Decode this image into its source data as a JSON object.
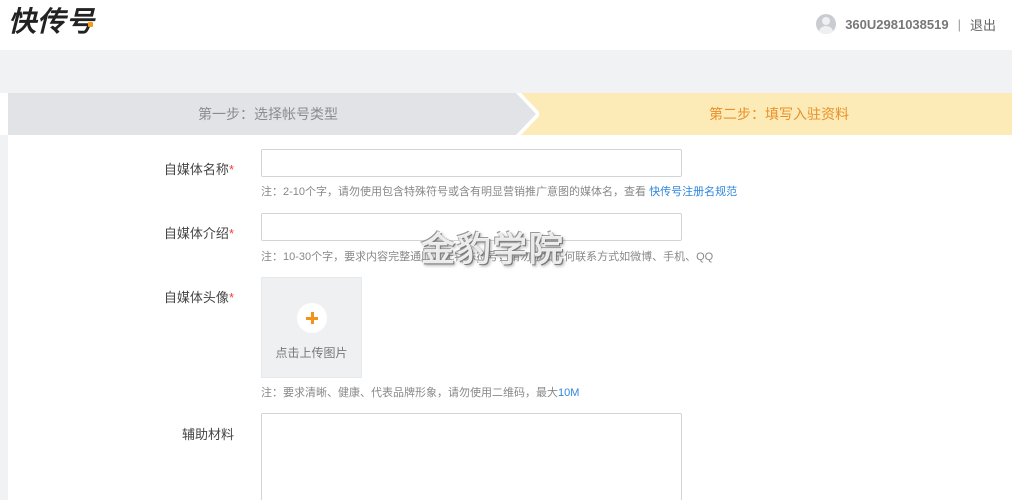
{
  "header": {
    "logo": "快传号",
    "username": "360U2981038519",
    "separator": "|",
    "logout": "退出"
  },
  "steps": [
    {
      "label": "第一步：选择帐号类型",
      "state": "done"
    },
    {
      "label": "第二步：填写入驻资料",
      "state": "active"
    }
  ],
  "form": {
    "name": {
      "label": "自媒体名称",
      "required": "*",
      "value": "",
      "hint": "注：2-10个字，请勿使用包含特殊符号或含有明显营销推广意图的媒体名，查看",
      "hint_link": "快传号注册名规范"
    },
    "intro": {
      "label": "自媒体介绍",
      "required": "*",
      "value": "",
      "hint": "注：10-30个字，要求内容完整通顺，无特殊符号，请勿添加任何联系方式如微博、手机、QQ"
    },
    "avatar": {
      "label": "自媒体头像",
      "required": "*",
      "upload_text": "点击上传图片",
      "hint": "注：要求清晰、健康、代表品牌形象，请勿使用二维码，最大",
      "hint_size": "10M"
    },
    "materials": {
      "label": "辅助材料",
      "value": ""
    }
  },
  "watermark": "金豹学院",
  "colors": {
    "accent": "#f2921c",
    "active_step_bg": "#fdebb7",
    "active_step_text": "#e8902b",
    "done_step_bg": "#e1e3e6",
    "link": "#2e86de",
    "required": "#e6453a"
  }
}
